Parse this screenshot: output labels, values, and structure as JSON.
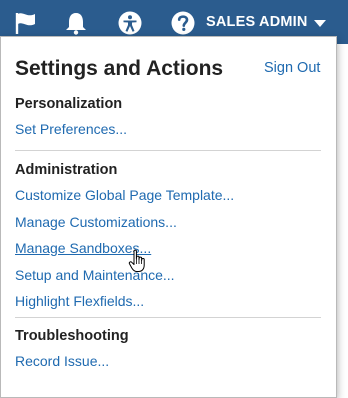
{
  "header": {
    "icons": [
      "flag-icon",
      "bell-icon",
      "accessibility-icon",
      "help-icon"
    ],
    "user_label": "SALES ADMIN",
    "colors": {
      "bar": "#2b5c8e",
      "link": "#1f6ab0"
    }
  },
  "panel": {
    "title": "Settings and Actions",
    "sign_out": "Sign Out",
    "sections": [
      {
        "title": "Personalization",
        "items": [
          "Set Preferences..."
        ]
      },
      {
        "title": "Administration",
        "items": [
          "Customize Global Page Template...",
          "Manage Customizations...",
          "Manage Sandboxes...",
          "Setup and Maintenance...",
          "Highlight Flexfields..."
        ]
      },
      {
        "title": "Troubleshooting",
        "items": [
          "Record Issue..."
        ]
      }
    ]
  }
}
